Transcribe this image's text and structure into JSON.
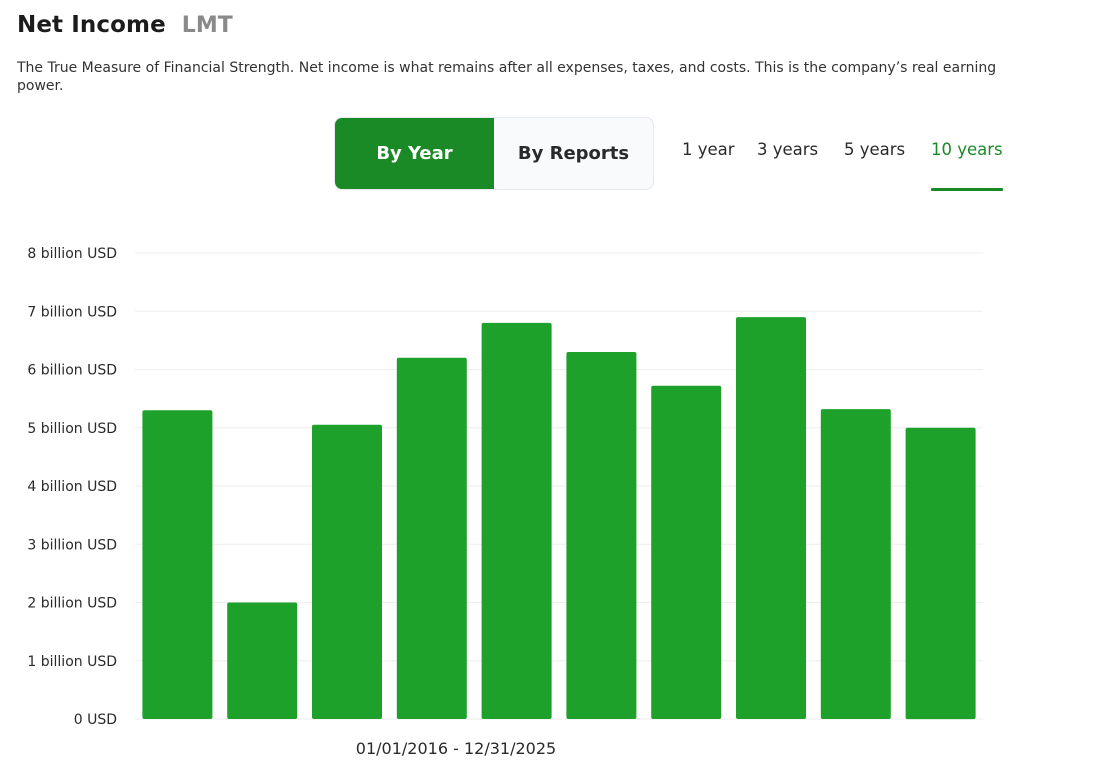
{
  "header": {
    "title": "Net Income",
    "ticker": "LMT",
    "description": "The True Measure of Financial Strength. Net income is what remains after all expenses, taxes, and costs. This is the company’s real earning power."
  },
  "view_toggle": {
    "by_year_label": "By Year",
    "by_reports_label": "By Reports",
    "selected": "By Year"
  },
  "periods": {
    "items": [
      "1 year",
      "3 years",
      "5 years",
      "10 years"
    ],
    "selected": "10 years"
  },
  "colors": {
    "accent": "#1a8a26",
    "bar": "#1ea12b",
    "grid": "#eeeeee"
  },
  "chart_data": {
    "type": "bar",
    "title": "",
    "xlabel": "01/01/2016 - 12/31/2025",
    "ylabel": "",
    "ylim": [
      0,
      8
    ],
    "yticks": [
      0,
      1,
      2,
      3,
      4,
      5,
      6,
      7,
      8
    ],
    "ytick_labels": [
      "0 USD",
      "1 billion USD",
      "2 billion USD",
      "3 billion USD",
      "4 billion USD",
      "5 billion USD",
      "6 billion USD",
      "7 billion USD",
      "8 billion USD"
    ],
    "grid": true,
    "values": [
      5.3,
      2.0,
      5.05,
      6.2,
      6.8,
      6.3,
      5.72,
      6.9,
      5.32,
      5.0
    ]
  }
}
